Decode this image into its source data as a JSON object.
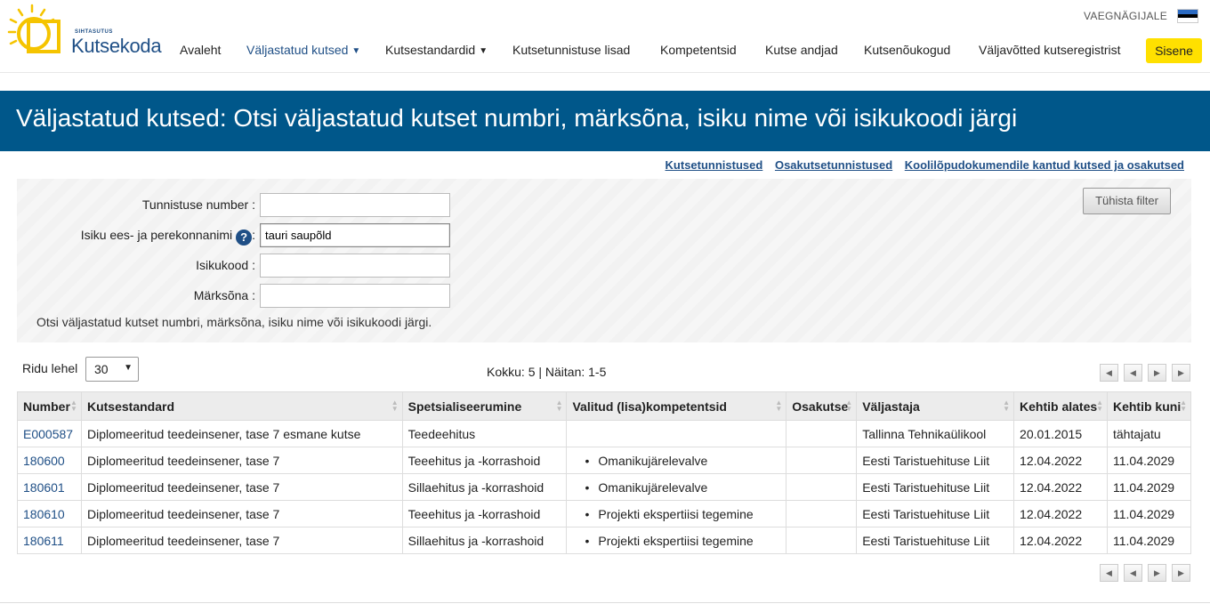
{
  "header": {
    "logo_small": "SIHTASUTUS",
    "logo_big": "Kutsekoda",
    "lang": "VAEGNÄGIJALE",
    "signin": "Sisene",
    "nav": [
      {
        "label": "Avaleht"
      },
      {
        "label": "Väljastatud kutsed",
        "caret": "▼"
      },
      {
        "label": "Kutsestandardid",
        "caret": "▼"
      },
      {
        "label": "Kutsetunnistuse lisad"
      },
      {
        "label": "Kompetentsid"
      },
      {
        "label": "Kutse andjad"
      },
      {
        "label": "Kutsenõukogud"
      },
      {
        "label": "Väljavõtted kutseregistrist"
      }
    ]
  },
  "banner": {
    "title": "Väljastatud kutsed: Otsi väljastatud kutset numbri, märksõna, isiku nime või isikukoodi järgi"
  },
  "sublinks": [
    "Kutsetunnistused",
    "Osakutsetunnistused",
    "Koolilõpudokumendile kantud kutsed ja osakutsed"
  ],
  "filter": {
    "number_label": "Tunnistuse number :",
    "number_value": "",
    "name_label": "Isiku ees- ja perekonnanimi",
    "name_help": "?",
    "name_colon": ":",
    "name_value": "tauri saupõld",
    "code_label": "Isikukood :",
    "code_value": "",
    "keyword_label": "Märksõna :",
    "keyword_value": "",
    "note": "Otsi väljastatud kutset numbri, märksõna, isiku nime või isikukoodi järgi.",
    "clear_button": "Tühista filter"
  },
  "results": {
    "rows_per_page_label": "Ridu lehel",
    "rows_per_page_value": "30",
    "total_text": "Kokku: 5 | Näitan: 1-5",
    "pager_icons": [
      "first-page-icon",
      "prev-page-icon",
      "next-page-icon",
      "last-page-icon"
    ]
  },
  "table": {
    "columns": [
      "Number",
      "Kutsestandard",
      "Spetsialiseerumine",
      "Valitud (lisa)kompetentsid",
      "Osakutse",
      "Väljastaja",
      "Kehtib alates",
      "Kehtib kuni"
    ],
    "rows": [
      {
        "number": "E000587",
        "standard": "Diplomeeritud teedeinsener, tase 7 esmane kutse",
        "spec": "Teedeehitus",
        "comp": "",
        "partial": "",
        "issuer": "Tallinna Tehnikaülikool",
        "from": "20.01.2015",
        "to": "tähtajatu"
      },
      {
        "number": "180600",
        "standard": "Diplomeeritud teedeinsener, tase 7",
        "spec": "Teeehitus ja -korrashoid",
        "comp": "Omanikujärelevalve",
        "partial": "",
        "issuer": "Eesti Taristuehituse Liit",
        "from": "12.04.2022",
        "to": "11.04.2029"
      },
      {
        "number": "180601",
        "standard": "Diplomeeritud teedeinsener, tase 7",
        "spec": "Sillaehitus ja -korrashoid",
        "comp": "Omanikujärelevalve",
        "partial": "",
        "issuer": "Eesti Taristuehituse Liit",
        "from": "12.04.2022",
        "to": "11.04.2029"
      },
      {
        "number": "180610",
        "standard": "Diplomeeritud teedeinsener, tase 7",
        "spec": "Teeehitus ja -korrashoid",
        "comp": "Projekti ekspertiisi tegemine",
        "partial": "",
        "issuer": "Eesti Taristuehituse Liit",
        "from": "12.04.2022",
        "to": "11.04.2029"
      },
      {
        "number": "180611",
        "standard": "Diplomeeritud teedeinsener, tase 7",
        "spec": "Sillaehitus ja -korrashoid",
        "comp": "Projekti ekspertiisi tegemine",
        "partial": "",
        "issuer": "Eesti Taristuehituse Liit",
        "from": "12.04.2022",
        "to": "11.04.2029"
      }
    ]
  },
  "colors": {
    "brand_blue": "#00578a",
    "link_blue": "#1f4f86",
    "signin_yellow": "#ffe000",
    "logo_yellow": "#f5c400"
  }
}
